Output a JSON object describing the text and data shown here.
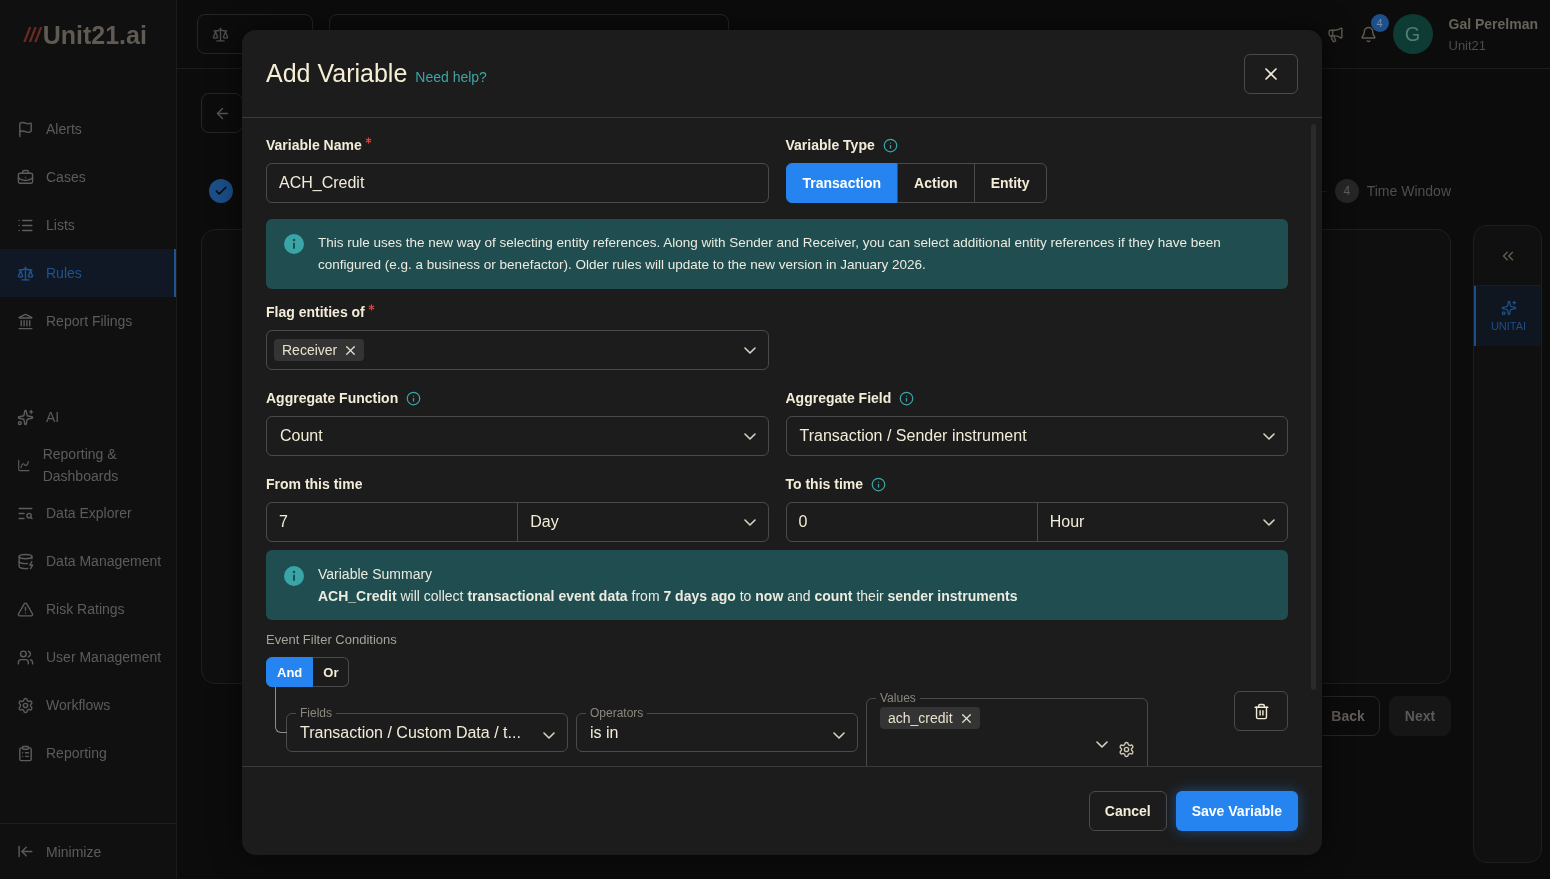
{
  "brand": {
    "logo_mark": "///",
    "logo": "Unit21.ai"
  },
  "sidebar": {
    "items": [
      {
        "label": "Alerts",
        "selected": false
      },
      {
        "label": "Cases",
        "selected": false
      },
      {
        "label": "Lists",
        "selected": false
      },
      {
        "label": "Rules",
        "selected": true
      },
      {
        "label": "Report Filings",
        "selected": false
      },
      {
        "label": "AI",
        "selected": false
      },
      {
        "label": "Reporting & Dashboards",
        "selected": false
      },
      {
        "label": "Data Explorer",
        "selected": false
      },
      {
        "label": "Data Management",
        "selected": false
      },
      {
        "label": "Risk Ratings",
        "selected": false
      },
      {
        "label": "User Management",
        "selected": false
      },
      {
        "label": "Workflows",
        "selected": false
      },
      {
        "label": "Reporting",
        "selected": false
      }
    ],
    "footer": {
      "label": "Minimize"
    }
  },
  "topbar": {
    "notifications": "4",
    "user": {
      "initial": "G",
      "name": "Gal Perelman",
      "org": "Unit21"
    }
  },
  "stepper": {
    "steps": [
      {
        "completed": true
      },
      {
        "number": "4",
        "label": "Time Window",
        "completed": false
      }
    ]
  },
  "wizard_buttons": [
    {
      "label": "Back",
      "disabled": false
    },
    {
      "label": "Next",
      "disabled": true
    }
  ],
  "assistant_panel": {
    "tabs": [
      {
        "label": "UNITAI",
        "selected": true
      }
    ]
  },
  "modal": {
    "title": "Add Variable",
    "help_link": "Need help?",
    "variable_name": {
      "label": "Variable Name",
      "required": true,
      "value": "ACH_Credit"
    },
    "variable_type": {
      "label": "Variable Type",
      "info": true,
      "options": [
        {
          "label": "Transaction",
          "selected": true
        },
        {
          "label": "Action",
          "selected": false
        },
        {
          "label": "Entity",
          "selected": false
        }
      ]
    },
    "info_banner": "This rule uses the new way of selecting entity references. Along with Sender and Receiver, you can select additional entity references if they have been configured (e.g. a business or benefactor). Older rules will update to the new version in January 2026.",
    "flag_entities": {
      "label": "Flag entities of",
      "required": true,
      "tags": [
        "Receiver"
      ]
    },
    "aggregate_function": {
      "label": "Aggregate Function",
      "info": true,
      "value": "Count"
    },
    "aggregate_field": {
      "label": "Aggregate Field",
      "info": true,
      "value": "Transaction / Sender instrument"
    },
    "from_time": {
      "label": "From this time",
      "amount": "7",
      "unit": "Day"
    },
    "to_time": {
      "label": "To this time",
      "info": true,
      "amount": "0",
      "unit": "Hour"
    },
    "summary": {
      "title": "Variable Summary",
      "text": "**ACH_Credit** will collect **transactional event data** from **7 days ago** to **now** and **count** their **sender instruments**"
    },
    "filter": {
      "label": "Event Filter Conditions",
      "logic": [
        {
          "label": "And",
          "selected": true
        },
        {
          "label": "Or",
          "selected": false
        }
      ],
      "condition": {
        "fields_label": "Fields",
        "field": "Transaction / Custom Data / t...",
        "operators_label": "Operators",
        "operator": "is in",
        "values_label": "Values",
        "values": [
          "ach_credit"
        ]
      }
    },
    "buttons": {
      "cancel": "Cancel",
      "save": "Save Variable"
    }
  }
}
